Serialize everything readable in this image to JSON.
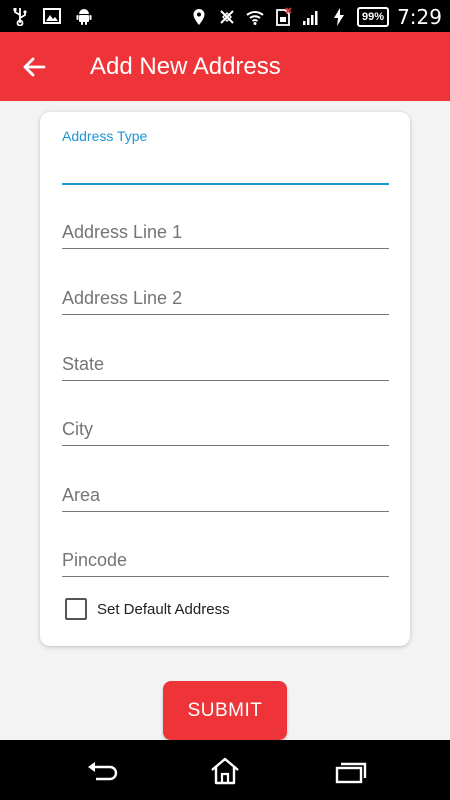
{
  "status_bar": {
    "time": "7:29",
    "battery": "99%",
    "left_icons": [
      "usb-icon",
      "image-icon",
      "android-icon"
    ],
    "right_icons": [
      "location-icon",
      "nfc-off-icon",
      "wifi-icon",
      "sim-icon",
      "signal-icon",
      "charging-icon"
    ]
  },
  "app_bar": {
    "title": "Add New Address",
    "back_icon": "arrow-left-icon",
    "color": "#ee3438"
  },
  "form": {
    "fields": [
      {
        "label": "Address Type",
        "state": "focused",
        "value": ""
      },
      {
        "placeholder": "Address Line 1",
        "value": ""
      },
      {
        "placeholder": "Address Line 2",
        "value": ""
      },
      {
        "placeholder": "State",
        "value": ""
      },
      {
        "placeholder": "City",
        "value": ""
      },
      {
        "placeholder": "Area",
        "value": ""
      },
      {
        "placeholder": "Pincode",
        "value": ""
      }
    ],
    "default_checkbox": {
      "label": "Set Default Address",
      "checked": false
    },
    "submit_label": "SUBMIT",
    "accent_color": "#1e96d3"
  },
  "nav_bar": {
    "buttons": [
      "back-nav-icon",
      "home-nav-icon",
      "recents-nav-icon"
    ]
  }
}
